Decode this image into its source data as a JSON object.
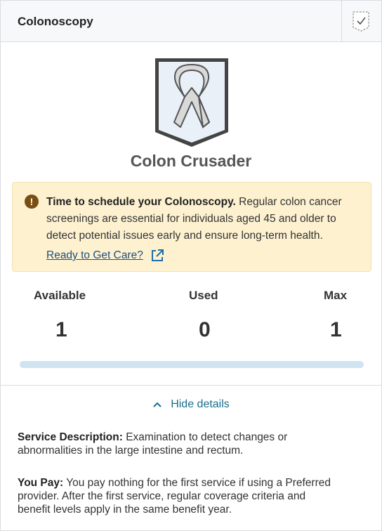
{
  "header": {
    "title": "Colonoscopy",
    "badge_icon": "checked-badge-icon"
  },
  "badge": {
    "name": "Colon Crusader",
    "icon": "awareness-ribbon-shield-icon"
  },
  "alert": {
    "icon": "exclamation-icon",
    "title": "Time to schedule your Colonoscopy.",
    "body": " Regular colon cancer screenings are essential for individuals aged 45 and older to detect potential issues early and ensure long-term health.",
    "link_label": "Ready to Get Care?",
    "link_icon": "external-link-icon",
    "color": "#fdf1d0"
  },
  "stats": {
    "available_label": "Available",
    "available_value": "1",
    "used_label": "Used",
    "used_value": "0",
    "max_label": "Max",
    "max_value": "1",
    "used_fraction": 0
  },
  "details_toggle": {
    "label": "Hide details",
    "icon": "chevron-up-icon"
  },
  "details": {
    "service_label": "Service Description:",
    "service_text": " Examination to detect changes or abnormalities in the large intestine and rectum.",
    "pay_label": "You Pay:",
    "pay_text": " You pay nothing for the first service if using a Preferred provider. After the first service, regular coverage criteria and benefit levels apply in the same benefit year."
  }
}
